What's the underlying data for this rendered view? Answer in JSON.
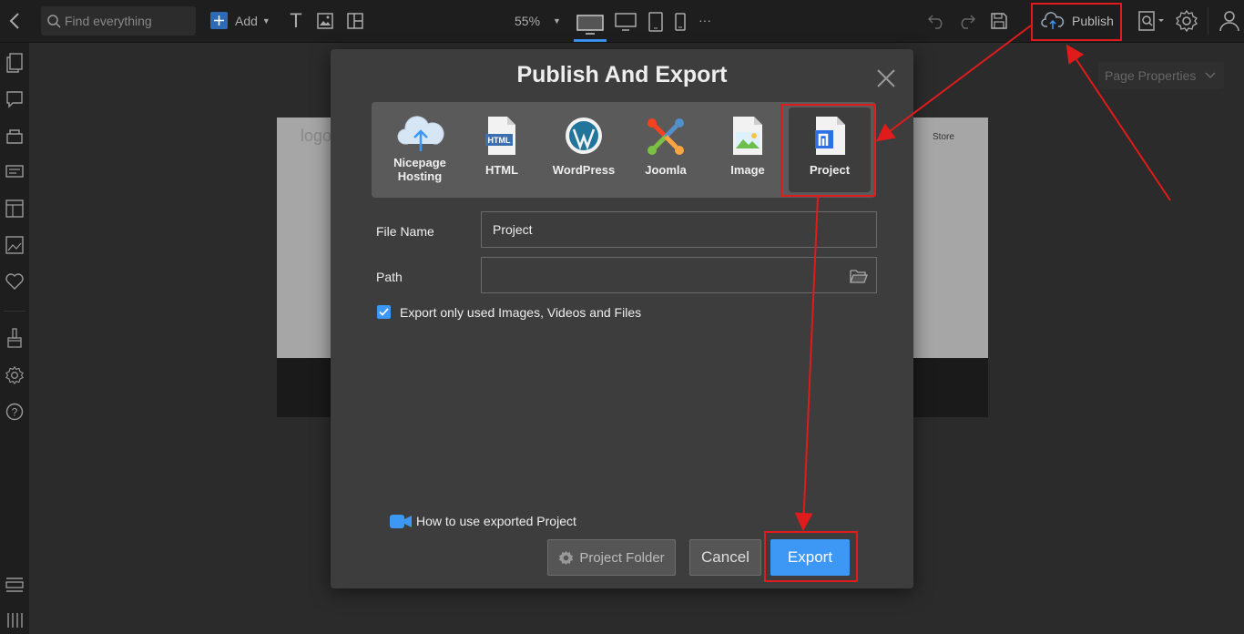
{
  "toolbar": {
    "search_placeholder": "Find everything",
    "add_label": "Add",
    "zoom": "55%",
    "more": "···",
    "publish_label": "Publish",
    "page_properties_label": "Page Properties"
  },
  "canvas": {
    "logo_text": "logo",
    "nav_store": "Store"
  },
  "dialog": {
    "title": "Publish And Export",
    "tabs": [
      {
        "label_line1": "Nicepage",
        "label_line2": "Hosting",
        "icon": "cloud-upload-icon"
      },
      {
        "label": "HTML",
        "icon": "html-file-icon",
        "badge": "HTML"
      },
      {
        "label": "WordPress",
        "icon": "wordpress-icon"
      },
      {
        "label": "Joomla",
        "icon": "joomla-icon"
      },
      {
        "label": "Image",
        "icon": "image-file-icon"
      },
      {
        "label": "Project",
        "icon": "nicepage-project-icon",
        "selected": true
      }
    ],
    "file_name_label": "File Name",
    "file_name_value": "Project",
    "path_label": "Path",
    "path_value": "",
    "checkbox_label": "Export only used Images, Videos and Files",
    "checkbox_checked": true,
    "help_link": "How to use exported Project",
    "project_folder_button": "Project Folder",
    "cancel_button": "Cancel",
    "export_button": "Export"
  },
  "colors": {
    "accent_blue": "#3d97f5",
    "annotation_red": "#e01b1b",
    "dialog_bg": "#3d3d3d",
    "topbar_bg": "#1e1e1e"
  }
}
